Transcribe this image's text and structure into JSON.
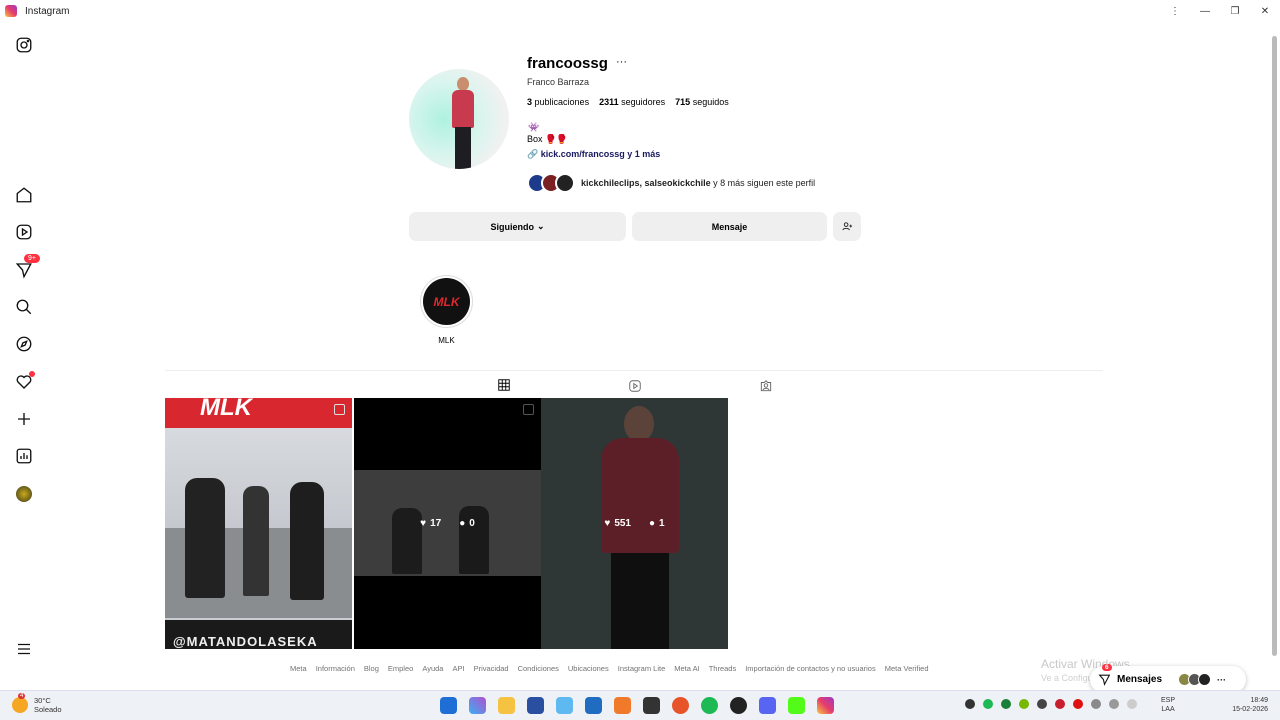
{
  "window": {
    "title": "Instagram",
    "controls": [
      "⋮",
      "—",
      "❐",
      "✕"
    ]
  },
  "sidebar": {
    "items": [
      {
        "name": "instagram-logo-icon"
      },
      {
        "name": "home-icon"
      },
      {
        "name": "reels-icon"
      },
      {
        "name": "direct-icon",
        "badge": "9+"
      },
      {
        "name": "search-icon"
      },
      {
        "name": "explore-icon"
      },
      {
        "name": "notifications-icon"
      },
      {
        "name": "create-icon"
      },
      {
        "name": "dashboard-icon"
      },
      {
        "name": "profile-avatar"
      },
      {
        "name": "menu-icon"
      }
    ]
  },
  "profile": {
    "username": "francoossg",
    "more": "···",
    "full_name": "Franco Barraza",
    "posts_count": "3",
    "posts_label": "publicaciones",
    "followers_count": "2311",
    "followers_label": "seguidores",
    "following_count": "715",
    "following_label": "seguidos",
    "bio_emoji": "👾",
    "bio_line": "Box 🥊🥊",
    "link": "kick.com/francossg y 1 más",
    "followed_by_names": "kickchileclips, salseokickchile",
    "followed_by_rest": "y 8 más siguen este perfil"
  },
  "actions": {
    "following_label": "Siguiendo",
    "message_label": "Mensaje"
  },
  "highlights": [
    {
      "label": "MLK",
      "logo_text": "MLK"
    }
  ],
  "posts": [
    {
      "likes": "",
      "comments": "",
      "caption_text": "MLK",
      "bottom_text": "@MATANDOLASEKA"
    },
    {
      "likes": "17",
      "comments": "0"
    },
    {
      "likes": "551",
      "comments": "1"
    }
  ],
  "footer": {
    "links": [
      "Meta",
      "Información",
      "Blog",
      "Empleo",
      "Ayuda",
      "API",
      "Privacidad",
      "Condiciones",
      "Ubicaciones",
      "Instagram Lite",
      "Meta AI",
      "Threads",
      "Importación de contactos y no usuarios",
      "Meta Verified"
    ]
  },
  "overlay": {
    "activate_title": "Activar Windows",
    "activate_sub": "Ve a Configuración para activar Windows.",
    "messages_label": "Mensajes",
    "messages_badge": "6"
  },
  "taskbar": {
    "weather_temp": "30°C",
    "weather_desc": "Soleado",
    "weather_badge": "4",
    "lang_top": "ESP",
    "lang_bottom": "LAA",
    "time": "18:49",
    "date": "15-02-2026"
  },
  "colors": {
    "accent": "#ff3040",
    "button_bg": "#efefef"
  }
}
